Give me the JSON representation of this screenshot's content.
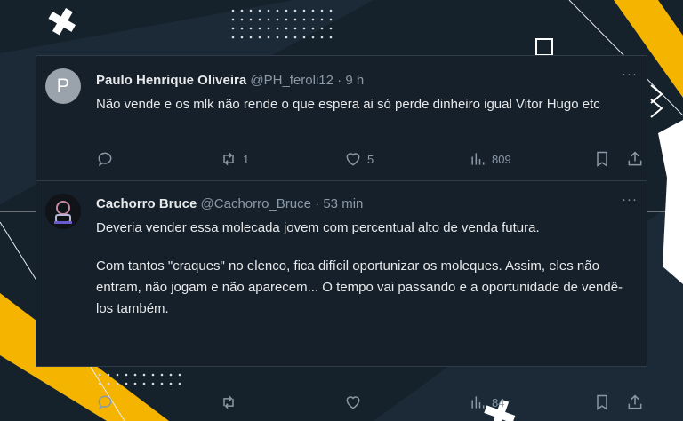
{
  "tweets": [
    {
      "avatar_letter": "P",
      "name": "Paulo Henrique Oliveira",
      "handle": "@PH_feroli12",
      "separator": "·",
      "time": "9 h",
      "text": [
        "Não vende e os mlk não rende o que espera ai só perde dinheiro igual Vitor Hugo etc"
      ],
      "replies": "",
      "retweets": "1",
      "likes": "5",
      "views": "809",
      "more": "···"
    },
    {
      "name": "Cachorro Bruce",
      "handle": "@Cachorro_Bruce",
      "separator": "·",
      "time": "53 min",
      "text": [
        "Deveria vender essa molecada jovem com percentual alto de venda futura.",
        "Com tantos \"craques\" no elenco, fica difícil oportunizar os moleques. Assim, eles não entram, não jogam e não aparecem... O tempo vai passando e a oportunidade de vendê-los também."
      ],
      "replies": "",
      "retweets": "",
      "likes": "",
      "views": "84",
      "more": "···"
    }
  ],
  "icons": {
    "reply": "reply-icon",
    "retweet": "retweet-icon",
    "like": "heart-icon",
    "views": "analytics-icon",
    "bookmark": "bookmark-icon",
    "share": "share-icon"
  },
  "colors": {
    "background": "#15212b",
    "card": "#15202b",
    "text": "#e7e9ea",
    "muted": "#8b98a5",
    "accent": "#f5b400"
  }
}
